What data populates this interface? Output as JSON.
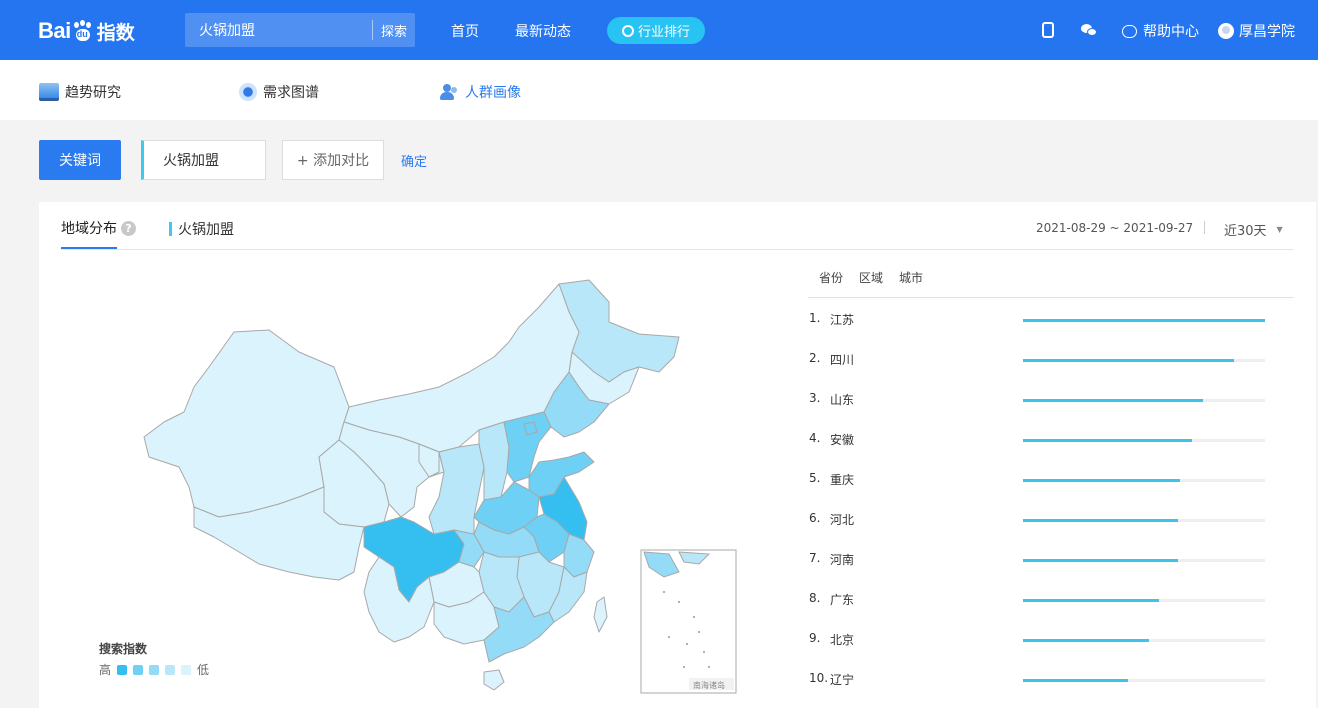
{
  "header": {
    "logo_text": "Bai",
    "logo_du": "du",
    "logo_index": "指数",
    "search_value": "火锅加盟",
    "search_button": "探索",
    "nav": [
      "首页",
      "最新动态"
    ],
    "rank_button": "行业排行",
    "help": "帮助中心",
    "academy": "厚昌学院"
  },
  "subnav": {
    "items": [
      {
        "label": "趋势研究",
        "icon": "trend-icon"
      },
      {
        "label": "需求图谱",
        "icon": "demand-icon"
      },
      {
        "label": "人群画像",
        "icon": "crowd-icon",
        "color": "#2b7bf0"
      }
    ]
  },
  "keyword_bar": {
    "label": "关键词",
    "keyword": "火锅加盟",
    "add_compare": "+ 添加对比",
    "confirm": "确定"
  },
  "region": {
    "tab": "地域分布",
    "help_icon": "?",
    "keyword": "火锅加盟",
    "date_range": "2021-08-29 ~ 2021-09-27",
    "period": "近30天",
    "legend_title": "搜索指数",
    "legend_high": "高",
    "legend_low": "低",
    "legend_colors": [
      "#35bff0",
      "#6dd0f4",
      "#93dbf6",
      "#b8e7f9",
      "#dbf3fc"
    ],
    "south_sea_label": "南海诸岛",
    "rank_tabs": [
      "省份",
      "区域",
      "城市"
    ],
    "ranking": [
      {
        "rank": "1.",
        "name": "江苏",
        "value": 1.0
      },
      {
        "rank": "2.",
        "name": "四川",
        "value": 0.87
      },
      {
        "rank": "3.",
        "name": "山东",
        "value": 0.745
      },
      {
        "rank": "4.",
        "name": "安徽",
        "value": 0.7
      },
      {
        "rank": "5.",
        "name": "重庆",
        "value": 0.65
      },
      {
        "rank": "6.",
        "name": "河北",
        "value": 0.64
      },
      {
        "rank": "7.",
        "name": "河南",
        "value": 0.64
      },
      {
        "rank": "8.",
        "name": "广东",
        "value": 0.56
      },
      {
        "rank": "9.",
        "name": "北京",
        "value": 0.52
      },
      {
        "rank": "10.",
        "name": "辽宁",
        "value": 0.435
      }
    ]
  }
}
